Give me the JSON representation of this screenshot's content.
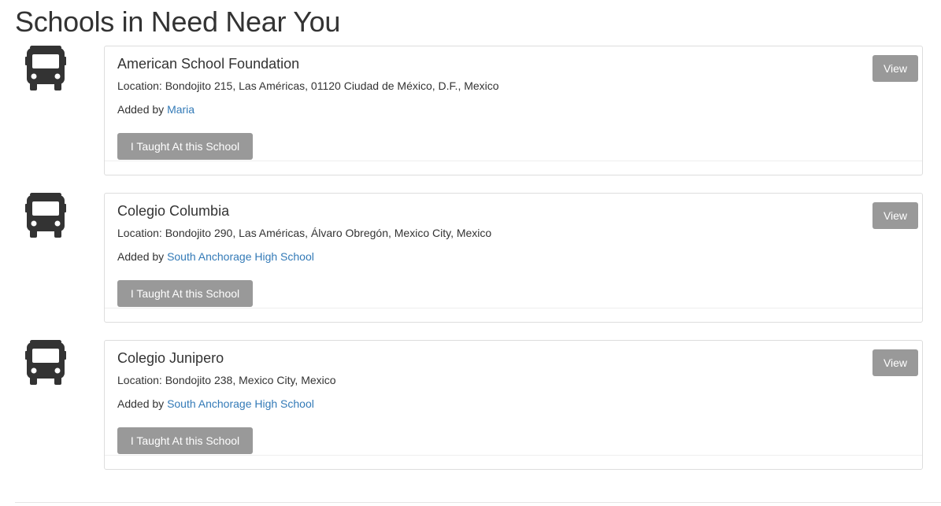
{
  "page": {
    "title": "Schools in Need Near You"
  },
  "schools": [
    {
      "name": "American School Foundation",
      "location": "Location: Bondojito 215, Las Américas, 01120 Ciudad de México, D.F., Mexico",
      "added_by_label": "Added by",
      "added_by": "Maria",
      "taught_label": "I Taught At this School",
      "view_label": "View",
      "icon": "bus-icon"
    },
    {
      "name": "Colegio Columbia",
      "location": "Location: Bondojito 290, Las Américas, Álvaro Obregón, Mexico City, Mexico",
      "added_by_label": "Added by",
      "added_by": "South Anchorage High School",
      "taught_label": "I Taught At this School",
      "view_label": "View",
      "icon": "bus-icon"
    },
    {
      "name": "Colegio Junipero",
      "location": "Location: Bondojito 238, Mexico City, Mexico",
      "added_by_label": "Added by",
      "added_by": "South Anchorage High School",
      "taught_label": "I Taught At this School",
      "view_label": "View",
      "icon": "bus-icon"
    }
  ],
  "colors": {
    "link": "#337ab7",
    "button": "#999999",
    "text": "#333333",
    "border": "#dddddd"
  }
}
